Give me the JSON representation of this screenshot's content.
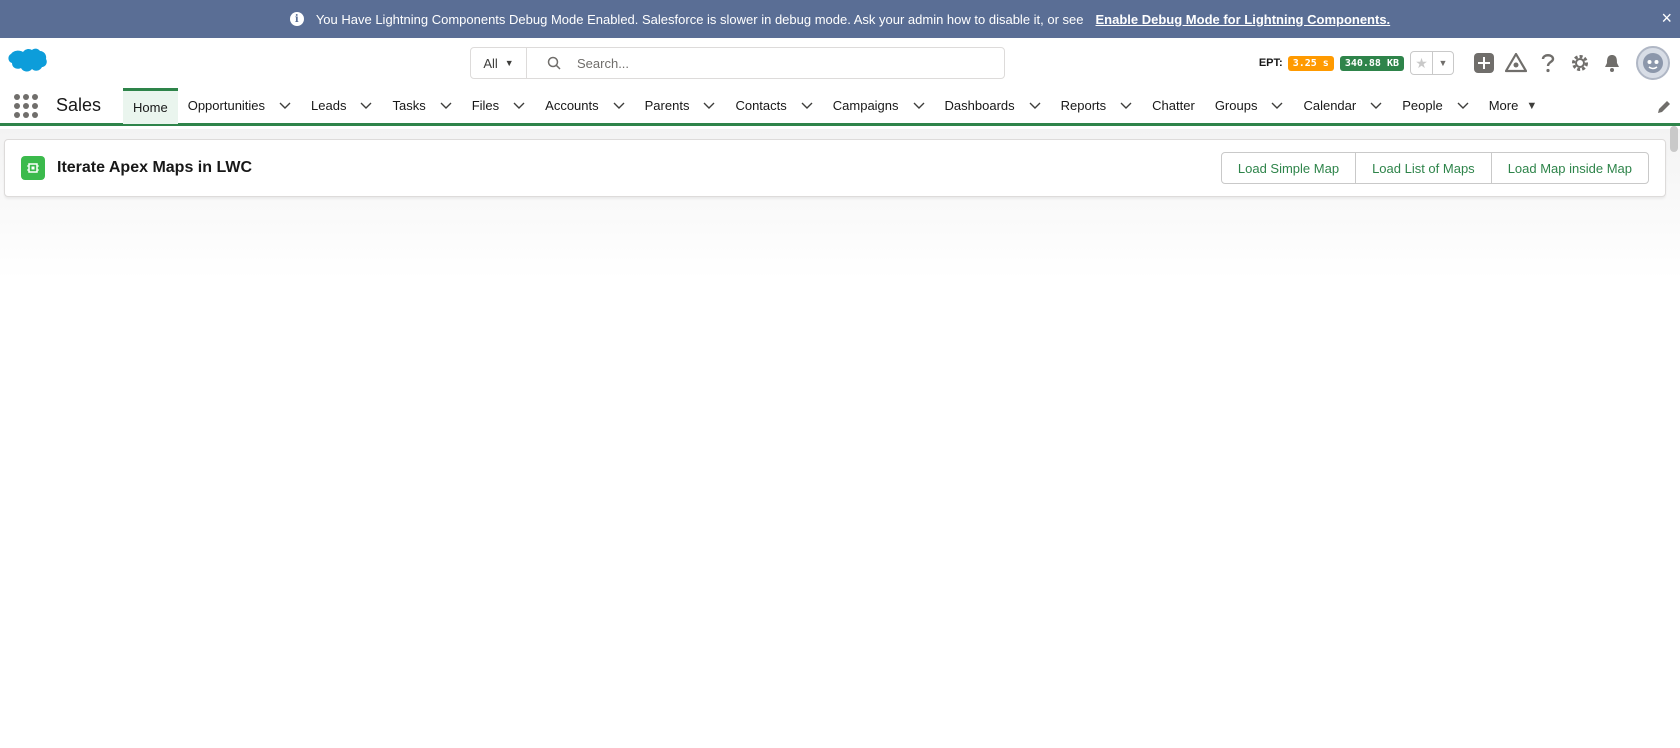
{
  "banner": {
    "message": "You Have Lightning Components Debug Mode Enabled. Salesforce is slower in debug mode. Ask your admin how to disable it, or see",
    "link": "Enable Debug Mode for Lightning Components.",
    "close": "×"
  },
  "header": {
    "search_scope": "All",
    "search_placeholder": "Search...",
    "ept_label": "EPT:",
    "ept_time": "3.25 s",
    "ept_size": "340.88 KB"
  },
  "nav": {
    "app_name": "Sales",
    "items": [
      {
        "label": "Home",
        "active": true,
        "dropdown": false
      },
      {
        "label": "Opportunities",
        "dropdown": true
      },
      {
        "label": "Leads",
        "dropdown": true
      },
      {
        "label": "Tasks",
        "dropdown": true
      },
      {
        "label": "Files",
        "dropdown": true
      },
      {
        "label": "Accounts",
        "dropdown": true
      },
      {
        "label": "Parents",
        "dropdown": true
      },
      {
        "label": "Contacts",
        "dropdown": true
      },
      {
        "label": "Campaigns",
        "dropdown": true
      },
      {
        "label": "Dashboards",
        "dropdown": true
      },
      {
        "label": "Reports",
        "dropdown": true
      },
      {
        "label": "Chatter",
        "dropdown": false
      },
      {
        "label": "Groups",
        "dropdown": true
      },
      {
        "label": "Calendar",
        "dropdown": true
      },
      {
        "label": "People",
        "dropdown": true
      }
    ],
    "more_label": "More"
  },
  "card": {
    "title": "Iterate Apex Maps in LWC",
    "buttons": [
      "Load Simple Map",
      "Load List of Maps",
      "Load Map inside Map"
    ]
  },
  "colors": {
    "banner": "#5a6e95",
    "accent_green": "#2e844a",
    "ept_orange": "#ff9a00"
  }
}
